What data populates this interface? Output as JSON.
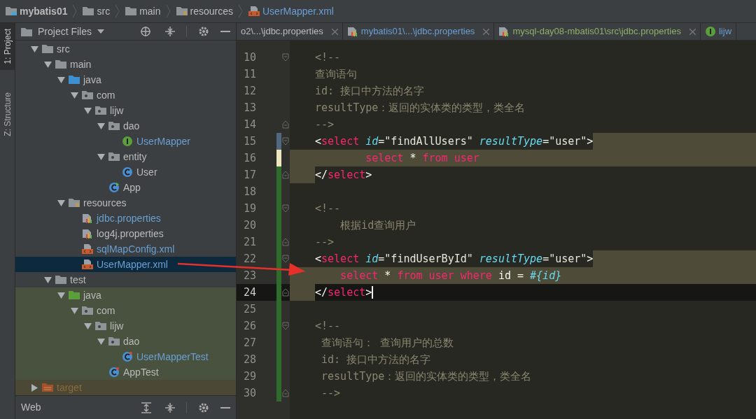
{
  "breadcrumbs": [
    {
      "label": "mybatis01",
      "kind": "module"
    },
    {
      "label": "src",
      "kind": "folder"
    },
    {
      "label": "main",
      "kind": "folder"
    },
    {
      "label": "resources",
      "kind": "resources"
    },
    {
      "label": "UserMapper.xml",
      "kind": "xml"
    }
  ],
  "tool_strip": [
    {
      "label": "1: Project",
      "selected": true
    },
    {
      "label": "Z: Structure",
      "selected": false
    }
  ],
  "project_panel": {
    "title": "Project Files",
    "tree": [
      {
        "label": "src",
        "kind": "folder",
        "expanded": true,
        "selected": false,
        "children": [
          {
            "label": "main",
            "kind": "folder",
            "expanded": true,
            "selected": false,
            "children": [
              {
                "label": "java",
                "kind": "source",
                "expanded": true,
                "selected": false,
                "children": [
                  {
                    "label": "com",
                    "kind": "package",
                    "expanded": true,
                    "selected": false,
                    "children": [
                      {
                        "label": "lijw",
                        "kind": "package",
                        "expanded": true,
                        "selected": false,
                        "children": [
                          {
                            "label": "dao",
                            "kind": "package",
                            "expanded": true,
                            "selected": false,
                            "children": [
                              {
                                "label": "UserMapper",
                                "kind": "interface",
                                "modified": true,
                                "selected": false
                              }
                            ]
                          },
                          {
                            "label": "entity",
                            "kind": "package",
                            "expanded": true,
                            "selected": false,
                            "children": [
                              {
                                "label": "User",
                                "kind": "class",
                                "modified": false,
                                "selected": false
                              }
                            ]
                          },
                          {
                            "label": "App",
                            "kind": "app",
                            "modified": false,
                            "selected": false
                          }
                        ]
                      }
                    ]
                  }
                ]
              },
              {
                "label": "resources",
                "kind": "resources",
                "expanded": true,
                "selected": false,
                "children": [
                  {
                    "label": "jdbc.properties",
                    "kind": "properties",
                    "modified": true,
                    "selected": false
                  },
                  {
                    "label": "log4j.properties",
                    "kind": "properties",
                    "modified": false,
                    "selected": false
                  },
                  {
                    "label": "sqlMapConfig.xml",
                    "kind": "xml",
                    "modified": true,
                    "selected": false
                  },
                  {
                    "label": "UserMapper.xml",
                    "kind": "xml",
                    "modified": true,
                    "selected": true
                  }
                ]
              }
            ]
          },
          {
            "label": "test",
            "kind": "folder",
            "expanded": true,
            "selected": false,
            "children": [
              {
                "label": "java",
                "kind": "test_source",
                "expanded": true,
                "selected": false,
                "children": [
                  {
                    "label": "com",
                    "kind": "package",
                    "expanded": true,
                    "selected": false,
                    "children": [
                      {
                        "label": "lijw",
                        "kind": "package",
                        "expanded": true,
                        "selected": false,
                        "children": [
                          {
                            "label": "dao",
                            "kind": "package",
                            "expanded": true,
                            "selected": false,
                            "children": [
                              {
                                "label": "UserMapperTest",
                                "kind": "test_class",
                                "modified": true,
                                "selected": false
                              }
                            ]
                          },
                          {
                            "label": "AppTest",
                            "kind": "test_class",
                            "modified": false,
                            "selected": false
                          }
                        ]
                      }
                    ]
                  }
                ]
              }
            ]
          }
        ]
      },
      {
        "label": "target",
        "kind": "excluded",
        "expanded": false,
        "selected": false
      }
    ]
  },
  "web_panel": {
    "title": "Web"
  },
  "tabs": [
    {
      "label": "o2\\...\\jdbc.properties",
      "kind": "plain",
      "modified": false,
      "closable": true
    },
    {
      "label": "mybatis01\\...\\jdbc.properties",
      "kind": "properties",
      "modified": true,
      "closable": true
    },
    {
      "label": "mysql-day08-mbatis01\\src\\jdbc.properties",
      "kind": "properties",
      "added": true,
      "closable": true
    },
    {
      "label": "lijw",
      "kind": "interface",
      "modified": true
    }
  ],
  "editor": {
    "lines": [
      {
        "number": "10",
        "kind": "plain",
        "changed": false,
        "edited": false,
        "added": false,
        "fold_start": true,
        "fold_end": false,
        "tokens": [
          {
            "kind": "comment",
            "text": "<!--"
          }
        ]
      },
      {
        "number": "11",
        "kind": "plain",
        "changed": false,
        "edited": false,
        "added": false,
        "fold_start": false,
        "fold_end": false,
        "tokens": [
          {
            "kind": "comment",
            "text": "查询语句"
          }
        ]
      },
      {
        "number": "12",
        "kind": "plain",
        "changed": false,
        "edited": false,
        "added": false,
        "fold_start": false,
        "fold_end": false,
        "tokens": [
          {
            "kind": "comment",
            "text": "id: 接口中方法的名字"
          }
        ]
      },
      {
        "number": "13",
        "kind": "plain",
        "changed": false,
        "edited": false,
        "added": false,
        "fold_start": false,
        "fold_end": false,
        "tokens": [
          {
            "kind": "comment",
            "text": "resultType：返回的实体类的类型，类全名"
          }
        ]
      },
      {
        "number": "14",
        "kind": "plain",
        "changed": false,
        "edited": false,
        "added": false,
        "fold_start": false,
        "fold_end": true,
        "tokens": [
          {
            "kind": "comment",
            "text": "-->"
          }
        ]
      },
      {
        "number": "15",
        "kind": "embed_open",
        "changed": true,
        "edited": false,
        "added": false,
        "fold_start": true,
        "fold_end": false,
        "tokens": [
          {
            "kind": "punct",
            "text": "<"
          },
          {
            "kind": "tag",
            "text": "select"
          },
          {
            "kind": "attr",
            "text": " id"
          },
          {
            "kind": "punct",
            "text": "="
          },
          {
            "kind": "string",
            "text": "\"findAllUsers\""
          },
          {
            "kind": "attr",
            "text": " resultType"
          },
          {
            "kind": "punct",
            "text": "="
          },
          {
            "kind": "string",
            "text": "\"user\""
          },
          {
            "kind": "punct",
            "text": ">"
          }
        ]
      },
      {
        "number": "16",
        "kind": "embed_body",
        "changed": false,
        "edited": true,
        "added": false,
        "fold_start": false,
        "fold_end": false,
        "tokens": [
          {
            "kind": "keyword",
            "text": "        select"
          },
          {
            "kind": "punct",
            "text": " * "
          },
          {
            "kind": "keyword",
            "text": "from user"
          }
        ]
      },
      {
        "number": "17",
        "kind": "embed_close",
        "changed": false,
        "edited": false,
        "added": true,
        "fold_start": false,
        "fold_end": true,
        "tokens": [
          {
            "kind": "punct",
            "text": "</"
          },
          {
            "kind": "tag",
            "text": "select"
          },
          {
            "kind": "punct",
            "text": ">"
          }
        ]
      },
      {
        "number": "18",
        "kind": "plain",
        "changed": false,
        "edited": false,
        "added": true,
        "fold_start": false,
        "fold_end": false
      },
      {
        "number": "19",
        "kind": "plain",
        "changed": false,
        "edited": false,
        "added": true,
        "fold_start": true,
        "fold_end": false,
        "tokens": [
          {
            "kind": "comment",
            "text": "<!--"
          }
        ]
      },
      {
        "number": "20",
        "kind": "plain",
        "changed": false,
        "edited": false,
        "added": true,
        "fold_start": false,
        "fold_end": false,
        "tokens": [
          {
            "kind": "comment",
            "text": "    根据id查询用户"
          }
        ]
      },
      {
        "number": "21",
        "kind": "plain",
        "changed": false,
        "edited": false,
        "added": true,
        "fold_start": false,
        "fold_end": true,
        "tokens": [
          {
            "kind": "comment",
            "text": "-->"
          }
        ]
      },
      {
        "number": "22",
        "kind": "embed_open",
        "changed": false,
        "edited": false,
        "added": true,
        "fold_start": true,
        "fold_end": false,
        "tokens": [
          {
            "kind": "punct",
            "text": "<"
          },
          {
            "kind": "tag",
            "text": "select"
          },
          {
            "kind": "attr",
            "text": " id"
          },
          {
            "kind": "punct",
            "text": "="
          },
          {
            "kind": "string",
            "text": "\"findUserById\""
          },
          {
            "kind": "attr",
            "text": " resultType"
          },
          {
            "kind": "punct",
            "text": "="
          },
          {
            "kind": "string",
            "text": "\"user\""
          },
          {
            "kind": "punct",
            "text": ">"
          }
        ]
      },
      {
        "number": "23",
        "kind": "embed_body",
        "changed": false,
        "edited": false,
        "added": true,
        "fold_start": false,
        "fold_end": false,
        "tokens": [
          {
            "kind": "keyword",
            "text": "    select"
          },
          {
            "kind": "punct",
            "text": " * "
          },
          {
            "kind": "keyword",
            "text": "from user where"
          },
          {
            "kind": "punct",
            "text": " id = "
          },
          {
            "kind": "param",
            "text": "#{id}"
          }
        ]
      },
      {
        "number": "24",
        "kind": "embed_close",
        "changed": false,
        "edited": false,
        "added": true,
        "fold_start": false,
        "fold_end": true,
        "current": true,
        "tokens": [
          {
            "kind": "punct",
            "text": "</"
          },
          {
            "kind": "tag",
            "text": "select"
          },
          {
            "kind": "punct",
            "text": ">"
          }
        ]
      },
      {
        "number": "25",
        "kind": "plain",
        "changed": false,
        "edited": false,
        "added": true,
        "fold_start": false,
        "fold_end": false
      },
      {
        "number": "26",
        "kind": "plain",
        "changed": false,
        "edited": false,
        "added": true,
        "fold_start": true,
        "fold_end": false,
        "tokens": [
          {
            "kind": "comment",
            "text": "<!--"
          }
        ]
      },
      {
        "number": "27",
        "kind": "plain",
        "changed": false,
        "edited": false,
        "added": true,
        "fold_start": false,
        "fold_end": false,
        "tokens": [
          {
            "kind": "comment",
            "text": " 查询语句： 查询用户的总数"
          }
        ]
      },
      {
        "number": "28",
        "kind": "plain",
        "changed": false,
        "edited": false,
        "added": true,
        "fold_start": false,
        "fold_end": false,
        "tokens": [
          {
            "kind": "comment",
            "text": " id: 接口中方法的名字"
          }
        ]
      },
      {
        "number": "29",
        "kind": "plain",
        "changed": false,
        "edited": false,
        "added": true,
        "fold_start": false,
        "fold_end": false,
        "tokens": [
          {
            "kind": "comment",
            "text": " resultType：返回的实体类的类型，类全名"
          }
        ]
      },
      {
        "number": "30",
        "kind": "plain",
        "changed": false,
        "edited": false,
        "added": true,
        "fold_start": false,
        "fold_end": true,
        "tokens": [
          {
            "kind": "comment",
            "text": " -->"
          }
        ]
      }
    ]
  }
}
